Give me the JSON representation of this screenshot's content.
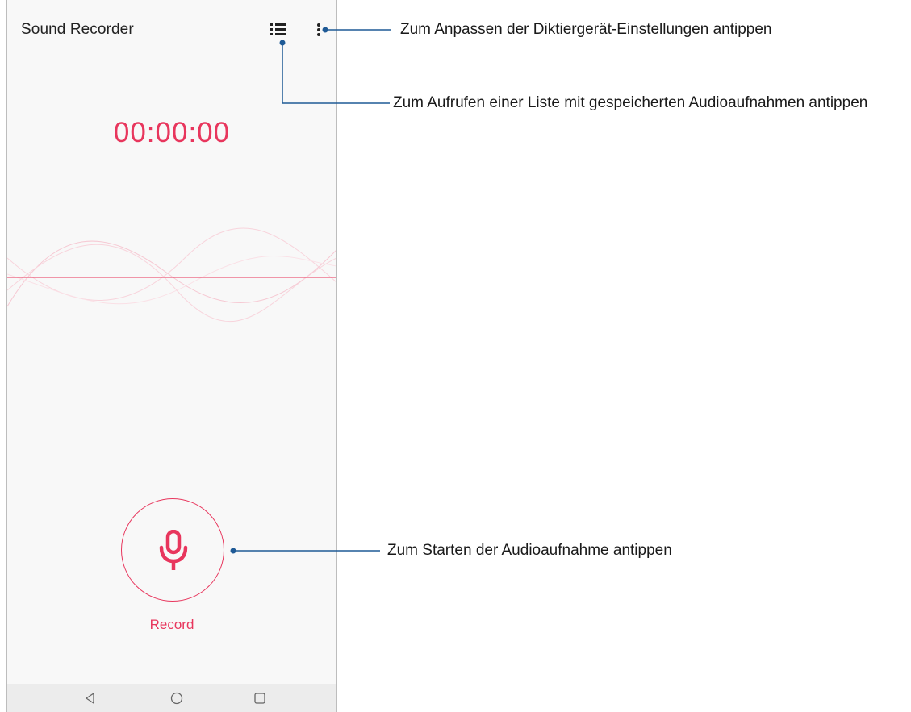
{
  "app": {
    "title": "Sound Recorder",
    "timer": "00:00:00",
    "record_label": "Record",
    "accent_color": "#e8365d"
  },
  "toolbar": {
    "list_icon": "list-icon",
    "more_icon": "more-vert-icon"
  },
  "navbar": {
    "back_icon": "back-triangle-icon",
    "home_icon": "home-circle-icon",
    "recents_icon": "recents-square-icon"
  },
  "callouts": {
    "settings": "Zum Anpassen der Diktiergerät-Einstellungen antippen",
    "list": "Zum Aufrufen einer Liste mit gespeicherten Audioaufnahmen antippen",
    "record": "Zum Starten der Audioaufnahme antippen",
    "line_color": "#1f5a96"
  }
}
